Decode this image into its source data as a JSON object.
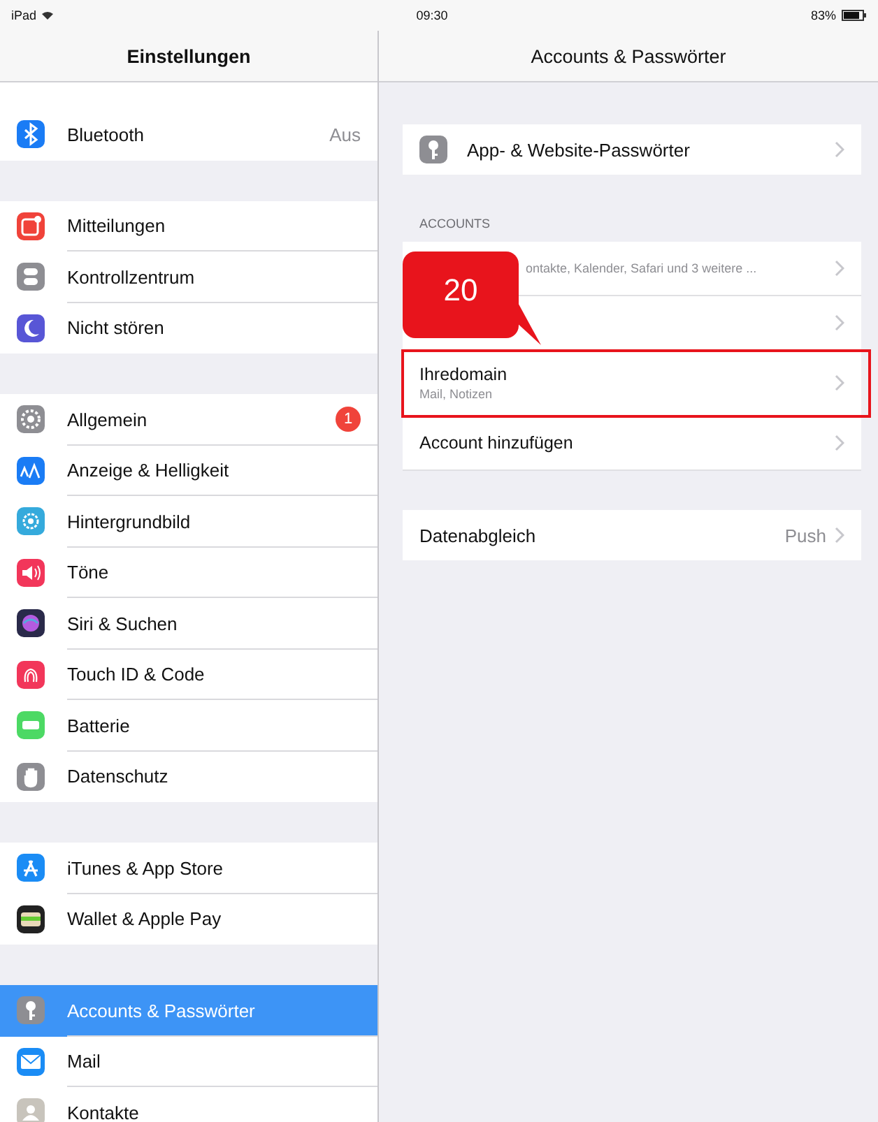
{
  "status_bar": {
    "device": "iPad",
    "time": "09:30",
    "battery": "83%"
  },
  "sidebar": {
    "title": "Einstellungen",
    "groups": [
      {
        "items": [
          {
            "label": "Bluetooth",
            "value": "Aus",
            "kind": "bluetooth",
            "color": "#1a7cf5",
            "selected": false
          }
        ]
      },
      {
        "items": [
          {
            "label": "Mitteilungen",
            "kind": "notification",
            "color": "#f0433a",
            "selected": false
          },
          {
            "label": "Kontrollzentrum",
            "kind": "switches",
            "color": "#8e8e93",
            "selected": false
          },
          {
            "label": "Nicht stören",
            "kind": "moon",
            "color": "#5856d6",
            "selected": false
          }
        ]
      },
      {
        "items": [
          {
            "label": "Allgemein",
            "badge": "1",
            "kind": "gear",
            "color": "#8e8e93",
            "selected": false
          },
          {
            "label": "Anzeige & Helligkeit",
            "kind": "text-size",
            "color": "#1a7cf5",
            "selected": false
          },
          {
            "label": "Hintergrundbild",
            "kind": "flower",
            "color": "#35aadc",
            "selected": false
          },
          {
            "label": "Töne",
            "kind": "speaker",
            "color": "#f2365a",
            "selected": false
          },
          {
            "label": "Siri & Suchen",
            "kind": "orb",
            "color": "#2a2a4a",
            "selected": false
          },
          {
            "label": "Touch ID & Code",
            "kind": "fingerprint",
            "color": "#f2365a",
            "selected": false
          },
          {
            "label": "Batterie",
            "kind": "battery",
            "color": "#4cd964",
            "selected": false
          },
          {
            "label": "Datenschutz",
            "kind": "hand",
            "color": "#8e8e93",
            "selected": false
          }
        ]
      },
      {
        "items": [
          {
            "label": "iTunes & App Store",
            "kind": "letter-a",
            "color": "#1a8cf5",
            "selected": false
          },
          {
            "label": "Wallet & Apple Pay",
            "kind": "wallet",
            "color": "#222222",
            "selected": false
          }
        ]
      },
      {
        "items": [
          {
            "label": "Accounts & Passwörter",
            "kind": "key",
            "color": "#8e8e93",
            "selected": true
          },
          {
            "label": "Mail",
            "kind": "envelope",
            "color": "#1a8cf5",
            "selected": false
          },
          {
            "label": "Kontakte",
            "kind": "person",
            "color": "#c8c4bc",
            "selected": false
          }
        ]
      }
    ]
  },
  "main": {
    "title": "Accounts & Passwörter",
    "passwords_row": {
      "label": "App- & Website-Passwörter",
      "kind": "key",
      "color": "#8e8e93"
    },
    "accounts_header": "ACCOUNTS",
    "accounts": [
      {
        "subtitle": "ontakte, Kalender, Safari und 3 weitere ...",
        "highlighted": false
      },
      {
        "highlighted": false
      },
      {
        "title": "Ihredomain",
        "subtitle": "Mail, Notizen",
        "highlighted": true
      },
      {
        "title": "Account hinzufügen",
        "highlighted": false
      }
    ],
    "sync_row": {
      "label": "Datenabgleich",
      "value": "Push"
    },
    "callout": {
      "label": "20"
    }
  }
}
